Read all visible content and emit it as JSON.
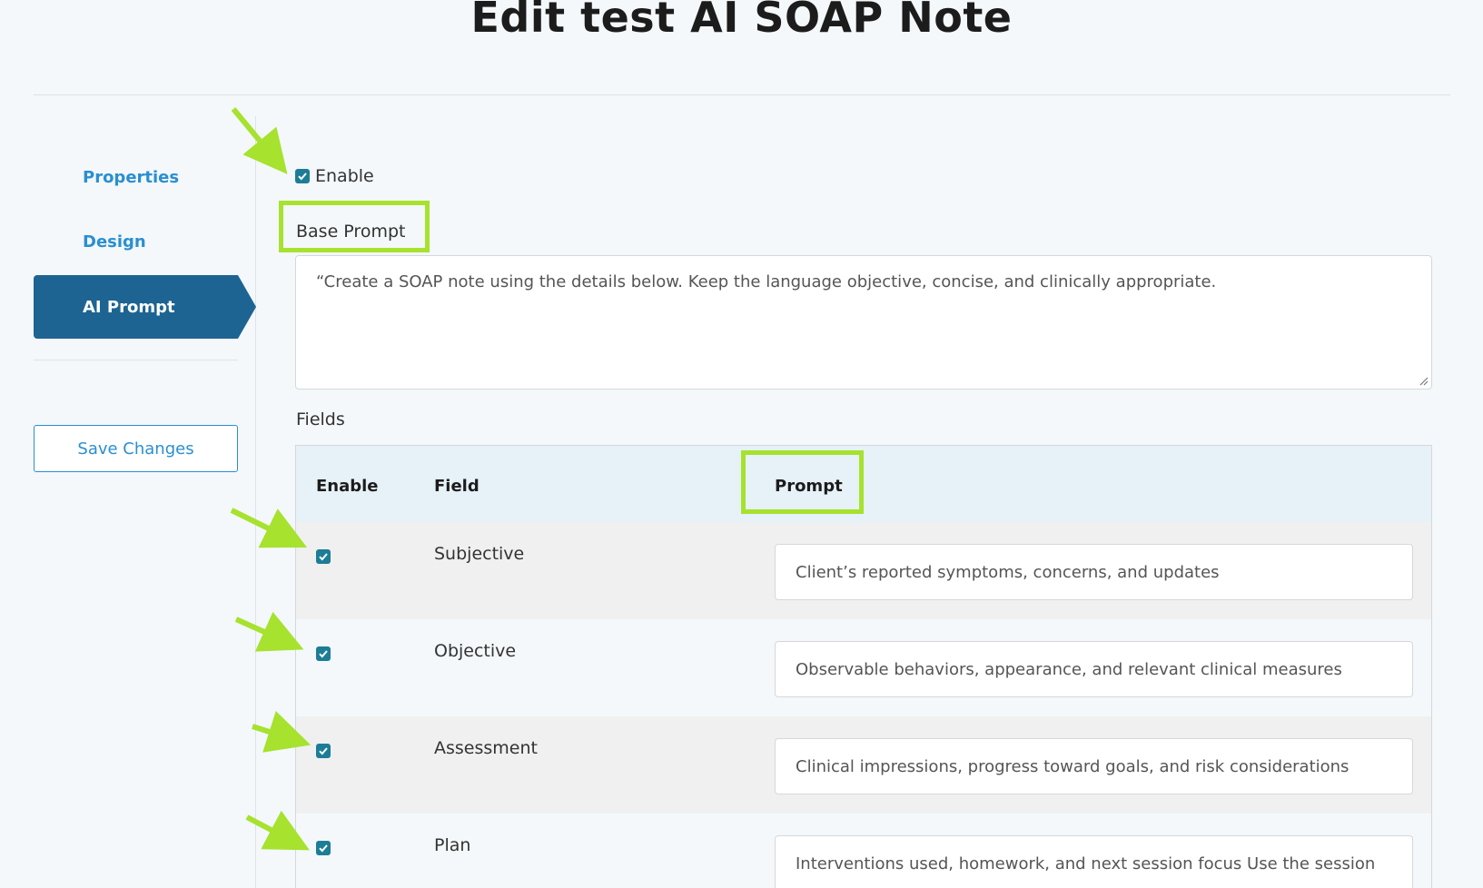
{
  "page": {
    "title": "Edit test AI SOAP Note"
  },
  "sidebar": {
    "items": [
      {
        "label": "Properties",
        "active": false
      },
      {
        "label": "Design",
        "active": false
      },
      {
        "label": "AI Prompt",
        "active": true
      }
    ],
    "save_label": "Save Changes"
  },
  "ai_prompt": {
    "enable_label": "Enable",
    "enabled": true,
    "base_prompt_label": "Base Prompt",
    "base_prompt_value": "“Create a SOAP note using the details below. Keep the language objective, concise, and clinically appropriate.",
    "fields_label": "Fields",
    "table": {
      "headers": {
        "enable": "Enable",
        "field": "Field",
        "prompt": "Prompt"
      },
      "rows": [
        {
          "enabled": true,
          "field": "Subjective",
          "prompt": "Client’s reported symptoms, concerns, and updates"
        },
        {
          "enabled": true,
          "field": "Objective",
          "prompt": "Observable behaviors, appearance, and relevant clinical measures"
        },
        {
          "enabled": true,
          "field": "Assessment",
          "prompt": "Clinical impressions, progress toward goals, and risk considerations"
        },
        {
          "enabled": true,
          "field": "Plan",
          "prompt": "Interventions used, homework, and next session focus Use the session"
        }
      ]
    }
  },
  "colors": {
    "accent": "#2a8fd0",
    "active_nav": "#1d6492",
    "checkbox": "#1d7d96",
    "annotation": "#a6e22e"
  }
}
